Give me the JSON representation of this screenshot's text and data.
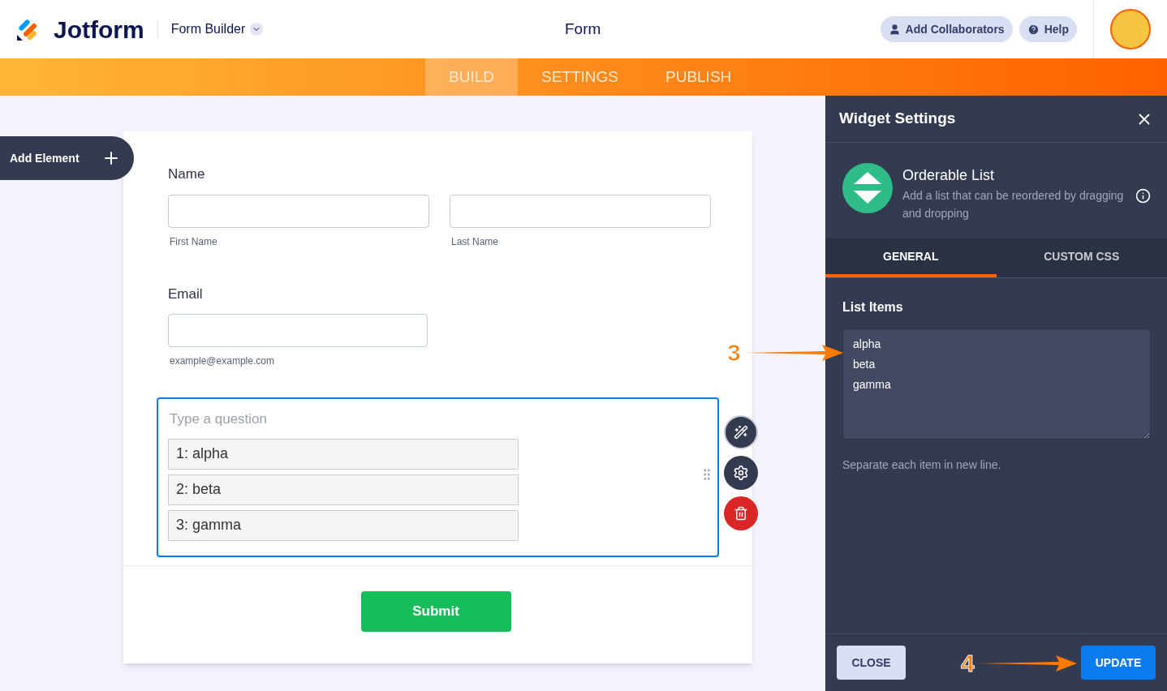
{
  "header": {
    "logo": "Jotform",
    "app_menu": "Form Builder",
    "title": "Form",
    "buttons": [
      {
        "kind": "collaborators",
        "label": "Add Collaborators"
      },
      {
        "kind": "help",
        "label": "Help"
      }
    ]
  },
  "nav_tabs": [
    {
      "label": "BUILD",
      "selected": true
    },
    {
      "label": "SETTINGS",
      "selected": false
    },
    {
      "label": "PUBLISH",
      "selected": false
    }
  ],
  "add_element": "Add Element",
  "form": {
    "name": {
      "label": "Name",
      "sublabels": [
        "First Name",
        "Last Name"
      ]
    },
    "email": {
      "label": "Email",
      "sublabel": "example@example.com"
    },
    "widget": {
      "placeholder": "Type a question",
      "selected": true,
      "items": [
        "1: alpha",
        "2: beta",
        "3: gamma"
      ]
    },
    "submit": "Submit"
  },
  "panel": {
    "title": "Widget Settings",
    "widget_name": "Orderable List",
    "widget_description": "Add a list that can be reordered by dragging and dropping",
    "tabs": [
      {
        "label": "GENERAL",
        "selected": true
      },
      {
        "label": "CUSTOM CSS",
        "selected": false
      }
    ],
    "list_items_label": "List Items",
    "list_items": "alpha\nbeta\ngamma",
    "hint": "Separate each item in new line.",
    "buttons": [
      {
        "kind": "secondary",
        "label": "CLOSE"
      },
      {
        "kind": "primary",
        "label": "UPDATE"
      }
    ]
  },
  "annotations": [
    {
      "label": "3"
    },
    {
      "label": "4"
    }
  ]
}
